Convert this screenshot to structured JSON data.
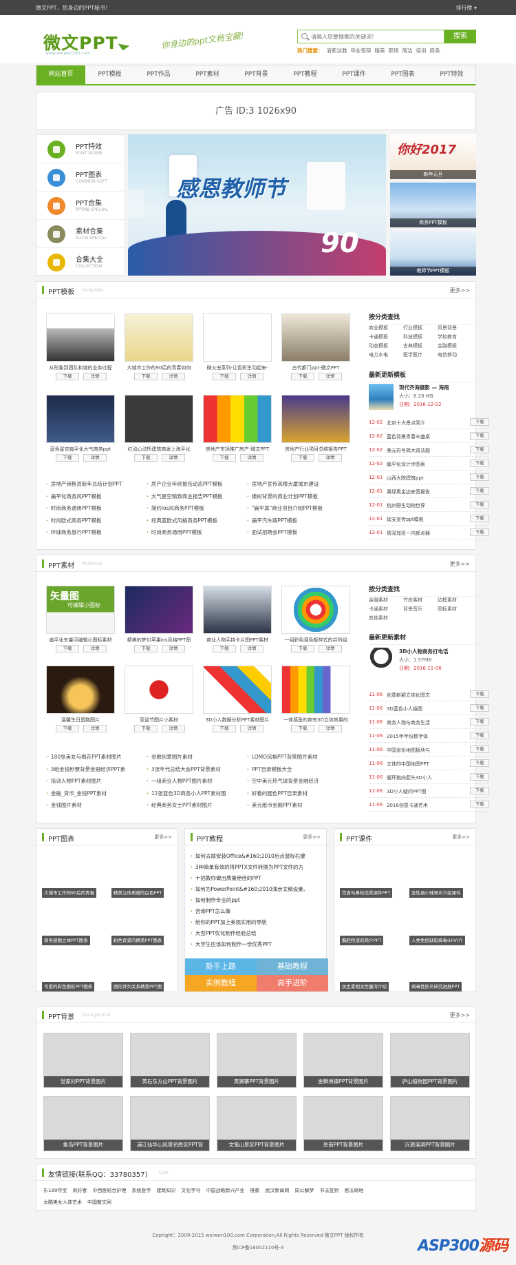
{
  "topbar": {
    "left": "微文PPT，您身边的PPT秘书！",
    "right": "排行榜 ▾"
  },
  "header": {
    "logo": "微文PPT",
    "logo_sub": "www.weiwen100.com",
    "slogan": "你身边的ppt文档宝藏!",
    "search_placeholder": "请输入您要搜索的关键词！",
    "search_button": "搜索",
    "hot_label": "热门搜索：",
    "hot": [
      "清新淡雅",
      "毕业答辩",
      "精美",
      "职场",
      "简洁",
      "培训",
      "商务"
    ]
  },
  "nav": [
    "网站首页",
    "PPT模板",
    "PPT作品",
    "PPT素材",
    "PPT背景",
    "PPT教程",
    "PPT课件",
    "PPT图表",
    "PPT特效"
  ],
  "ad": "广告 ID:3 1026x90",
  "quick": [
    {
      "title": "PPT特效",
      "sub": "FONT DOWN",
      "color": "#6ab023"
    },
    {
      "title": "PPT图表",
      "sub": "COMMON SOFT",
      "color": "#3a8fd6"
    },
    {
      "title": "PPT合集",
      "sub": "PPTMB SPECIAL",
      "color": "#f0892c"
    },
    {
      "title": "素材合集",
      "sub": "SUCAI SPECIAL",
      "color": "#8a8a5c"
    },
    {
      "title": "合集大全",
      "sub": "COLLECTION",
      "color": "#e8b700"
    }
  ],
  "banner": {
    "title": "感恩教师节",
    "num": "90"
  },
  "side": [
    "新年元旦",
    "商务PPT模板",
    "教师节PPT模板"
  ],
  "side_top_text": "你好2017",
  "tpl": {
    "title": "PPT模板",
    "en": "template",
    "more": "更多>>",
    "download": "下载",
    "detail": "详情",
    "thumbs": [
      "从形象到团队和谐的业务过程",
      "大城市工作的90后的青春如何",
      "微火虫系列-让色彩生动起来-",
      "古代都门ppt-微文PPT",
      "蓝色星空扁平化大气商务ppt",
      "红动心动所建筑商发上海平化",
      "房地产市场推广房产-微文PPT",
      "房地产行业项目总结报告PPT"
    ],
    "cols": [
      [
        "房地产销售员新年总结计划PPT",
        "扁平化商务风PPT模板",
        "时尚商务通用PPT模板",
        "时尚欧式商务PPT模板",
        "环球商务旅行PPT模板"
      ],
      [
        "房产企业年终报告动态PPT模板",
        "大气星空精致商业报告PPT模板",
        "简约ios风商务PPT模板",
        "经典蓝欧式风格商务PPT模板",
        "时尚商务通用PPT模板"
      ],
      [
        "房地产宣传高楼大厦城市建设",
        "橡树背景的商业计划PPT模板",
        "\"扁平真\"商业项目介绍PPT模板",
        "扁平汽车路PPT模板",
        "面试招聘会PPT模板"
      ]
    ],
    "cat_title": "按分类查找",
    "cats": [
      "商业模板",
      "行业模板",
      "风景背景",
      "卡通模板",
      "科技模板",
      "学校教育",
      "动态模板",
      "古典模板",
      "金融模板",
      "电力水电",
      "医学医疗",
      "电信移动"
    ],
    "new_title": "最新更新模板",
    "feat_title": "现代齐海摄影 — 海南",
    "feat_size": "大小：6.28 MB",
    "feat_date": "日期：2016-12-02",
    "updates": [
      [
        "12-02",
        "北京十大景点简介"
      ],
      [
        "12-02",
        "蓝色背景青春丰盛桌"
      ],
      [
        "12-02",
        "美元符号简大背法题"
      ],
      [
        "12-02",
        "扁平化设计步图表"
      ],
      [
        "12-01",
        "山西大院建筑ppt"
      ],
      [
        "12-01",
        "果绿黑金边安音报告"
      ],
      [
        "12-01",
        "杭州野生动物世界"
      ],
      [
        "12-01",
        "延安宣传ppt模板"
      ],
      [
        "12-01",
        "情深加班一内部点器"
      ]
    ]
  },
  "mat": {
    "title": "PPT素材",
    "en": "material",
    "more": "更多>>",
    "download": "下载",
    "detail": "详情",
    "thumb_text": "矢量图",
    "thumb_text2": "可编辑小图标",
    "thumbs": [
      "扁平化矢量可编辑小图标素材",
      "精美的梦幻苹果ios风格PPT图",
      "商业人物手持卡片图PPT素材",
      "一组彩色调色板样式的并列组",
      "温馨生日蛋糕图片",
      "圣诞节图片小素材",
      "3D小人数据分析PPT素材图片",
      "一体感鱼的商有3D立体效果的"
    ],
    "cols": [
      [
        "180张美女与梅花PPT素材图片",
        "3组金钱秒票背景金融经济PPT素",
        "培训人物PPT素材图片",
        "金融_货币_金钱PPT素材",
        "金钱图片素材"
      ],
      [
        "金融创意图片素材",
        "3张年代总结大会PPT背景素材",
        "一组商业人物PPT图片素材",
        "11张蓝色3D商务小人PPT素材图",
        "经典商务女士PPT素材图片"
      ],
      [
        "LOMO风格PPT背景图片素材",
        "PPT目录模板大全",
        "空中美元热气球背景金融经济",
        "好看的圆色PPT目录素材",
        "美元纸币金融PPT素材"
      ]
    ],
    "cat_title": "按分类查找",
    "cats": [
      "金融素材",
      "节庆素材",
      "边框素材",
      "卡通素材",
      "背景音乐",
      "图标素材",
      "其他素材"
    ],
    "new_title": "最新更新素材",
    "feat_title": "3D小人物商务打电话",
    "feat_size": "大小：1.57MB",
    "feat_date": "日期：2016-11-06",
    "updates": [
      [
        "11-06",
        "创意新颖立体化图文"
      ],
      [
        "11-06",
        "3D蓝色小人插图"
      ],
      [
        "11-06",
        "商务人物与商务生活"
      ],
      [
        "11-06",
        "2015年年份数字体"
      ],
      [
        "11-06",
        "中国省份地图板块与"
      ],
      [
        "11-06",
        "立体的中国地图PPT"
      ],
      [
        "11-06",
        "循环指向箭头3D小人"
      ],
      [
        "11-06",
        "3D小人疑问PPT图"
      ],
      [
        "11-06",
        "2016创意卡通艺术"
      ]
    ]
  },
  "charts": {
    "title": "PPT图表",
    "more": "更多>>",
    "tags": [
      "大城市工作的90后的青春",
      "精美立体质感的白色PPT",
      "商务感图立体PPT图表",
      "粉色背景的精美PPT图表",
      "可爱的彩色图形PPT图表",
      "图形并列关系精美PPT图"
    ]
  },
  "tutorial": {
    "title": "PPT教程",
    "more": "更多>>",
    "items": [
      "如何去掉安装Office&#160;2010后点鼠标右键",
      "3种简单有效的将PPTX文件转换为PPT文件的方",
      "十招教你做出质量绝佳的PPT",
      "如何为PowerPoint&#160;2010演示文稿设置、",
      "如何制作专业的ppt",
      "咨询PPT怎么做",
      "给你的PPT加上美观实用的导航",
      "大型PPT优化制作经验总结",
      "大学生应该如何制作一份优秀PPT"
    ],
    "buttons": [
      "新手上路",
      "基础教程",
      "实例教程",
      "高手进阶"
    ]
  },
  "courseware": {
    "title": "PPT课件",
    "more": "更多>>",
    "tags": [
      "饮食与鼻检优秀课件PPT",
      "急性调小球肾炎介绍课件",
      "胸腔积液的简介PPT",
      "人类免疫缺陷病毒(HIV)介",
      "抗生素相关性腹泻介绍",
      "病毒性肝炎研究进展PPT"
    ]
  },
  "bgs": {
    "title": "PPT背景",
    "en": "background",
    "more": "更多>>",
    "items": [
      "党家村PPT背景图片",
      "黄石东方山PPT背景图片",
      "黄狮寨PPT背景图片",
      "金鳞洲镇PPT背景图片",
      "庐山植物园PPT背景图片",
      "象岛PPT背景图片",
      "浦江仙华山风景名胜区PPT背",
      "文笔山景区PPT背景图片",
      "岳南PPT背景图片",
      "沂源溶洞PPT背景图片"
    ]
  },
  "links": {
    "title": "友情链接(联系QQ：33780357)",
    "en": "Link",
    "row1": [
      "乐189夺宝",
      "尚好者",
      "中西医结合护理",
      "系统医学",
      "建筑知识",
      "文化学刊",
      "中国战略新兴产业",
      "推薪",
      "武汉新闻网",
      "周公解梦",
      "书法签到",
      "思法局地"
    ],
    "row2": [
      "太酷美女人体艺术",
      "中国散文网"
    ]
  },
  "footer": {
    "copy": "Copright：2009-2015 weiwen100.com Corporation,All Rights Reserved 微文PPT 版权所有",
    "icp": "黑ICP备16002110号-3"
  },
  "watermark": {
    "a": "ASP300",
    "b": "源码"
  }
}
